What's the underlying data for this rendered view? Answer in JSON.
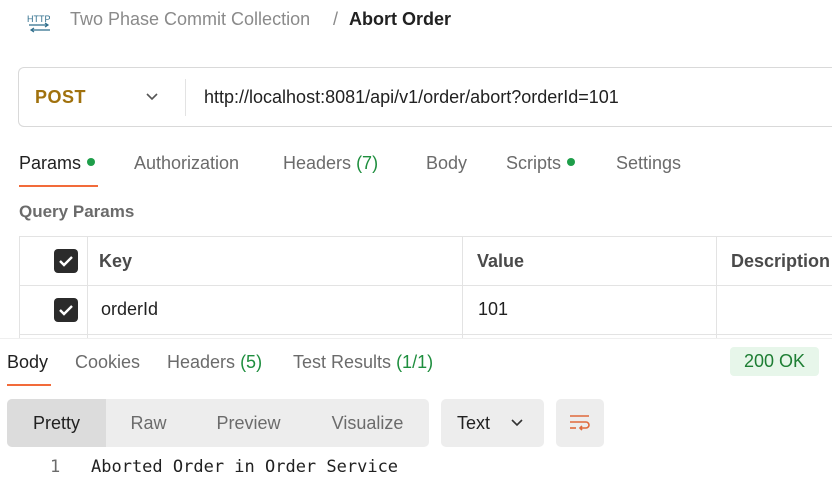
{
  "breadcrumb": {
    "badge_icon": "http-icon",
    "collection": "Two Phase Commit Collection",
    "separator": "/",
    "request_name": "Abort Order"
  },
  "request": {
    "method": "POST",
    "method_color": "#a0710d",
    "url": "http://localhost:8081/api/v1/order/abort?orderId=101"
  },
  "request_tabs": [
    {
      "label": "Params",
      "count": "",
      "dot": true,
      "active": true
    },
    {
      "label": "Authorization",
      "count": "",
      "dot": false,
      "active": false
    },
    {
      "label": "Headers",
      "count": "(7)",
      "dot": false,
      "active": false
    },
    {
      "label": "Body",
      "count": "",
      "dot": false,
      "active": false
    },
    {
      "label": "Scripts",
      "count": "",
      "dot": true,
      "active": false
    },
    {
      "label": "Settings",
      "count": "",
      "dot": false,
      "active": false
    }
  ],
  "query_params": {
    "title": "Query Params",
    "columns": [
      "Key",
      "Value",
      "Description"
    ],
    "rows": [
      {
        "checked": true,
        "key": "orderId",
        "value": "101",
        "description": ""
      }
    ]
  },
  "response_tabs": [
    {
      "label": "Body",
      "count": "",
      "active": true
    },
    {
      "label": "Cookies",
      "count": "",
      "active": false
    },
    {
      "label": "Headers",
      "count": "(5)",
      "active": false
    },
    {
      "label": "Test Results",
      "count": "(1/1)",
      "active": false
    }
  ],
  "status": {
    "text": "200 OK",
    "color": "#1e7e34"
  },
  "view_modes": [
    "Pretty",
    "Raw",
    "Preview",
    "Visualize"
  ],
  "active_view": "Pretty",
  "format": "Text",
  "wrap_icon": "wrap-lines-icon",
  "response_body": {
    "lines": [
      {
        "number": "1",
        "text": "Aborted Order in Order Service"
      }
    ]
  },
  "accent_color": "#f26b3a"
}
